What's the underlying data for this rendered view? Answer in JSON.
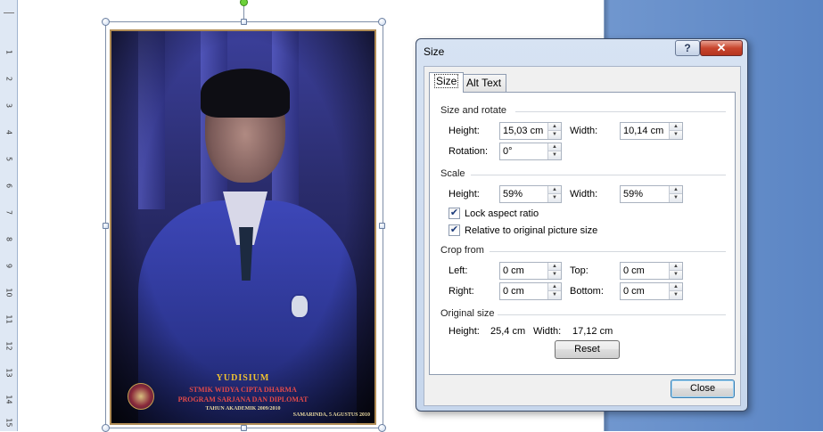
{
  "ruler": {
    "numbers": [
      "1",
      "2",
      "3",
      "4",
      "5",
      "6",
      "7",
      "8",
      "9",
      "10",
      "11",
      "12",
      "13",
      "14",
      "15"
    ]
  },
  "photo": {
    "caption_title": "YUDISIUM",
    "caption_line1": "STMIK WIDYA CIPTA DHARMA",
    "caption_line2": "PROGRAM SARJANA DAN DIPLOMAT",
    "caption_line3": "TAHUN AKADEMIK 2009/2010",
    "caption_date": "SAMARINDA, 5 AGUSTUS 2010"
  },
  "dialog": {
    "title": "Size",
    "help_label": "?",
    "close_label": "✕",
    "tabs": [
      {
        "label": "Size",
        "active": true
      },
      {
        "label": "Alt Text",
        "active": false
      }
    ],
    "size_rotate": {
      "section": "Size and rotate",
      "height_label": "Height:",
      "height_value": "15,03 cm",
      "width_label": "Width:",
      "width_value": "10,14 cm",
      "rotation_label": "Rotation:",
      "rotation_value": "0°"
    },
    "scale": {
      "section": "Scale",
      "height_label": "Height:",
      "height_value": "59%",
      "width_label": "Width:",
      "width_value": "59%",
      "lock_aspect_label": "Lock aspect ratio",
      "lock_aspect_checked": true,
      "relative_label": "Relative to original picture size",
      "relative_checked": true
    },
    "crop": {
      "section": "Crop from",
      "left_label": "Left:",
      "left_value": "0 cm",
      "top_label": "Top:",
      "top_value": "0 cm",
      "right_label": "Right:",
      "right_value": "0 cm",
      "bottom_label": "Bottom:",
      "bottom_value": "0 cm"
    },
    "original": {
      "section": "Original size",
      "height_label": "Height:",
      "height_value": "25,4 cm",
      "width_label": "Width:",
      "width_value": "17,12 cm",
      "reset_label": "Reset"
    },
    "close_button_label": "Close"
  },
  "colors": {
    "app_background": "#7fa3d6",
    "dialog_frame": "#c6d6ec",
    "close_accent": "#c8452e",
    "rotate_handle": "#6cd13a"
  }
}
